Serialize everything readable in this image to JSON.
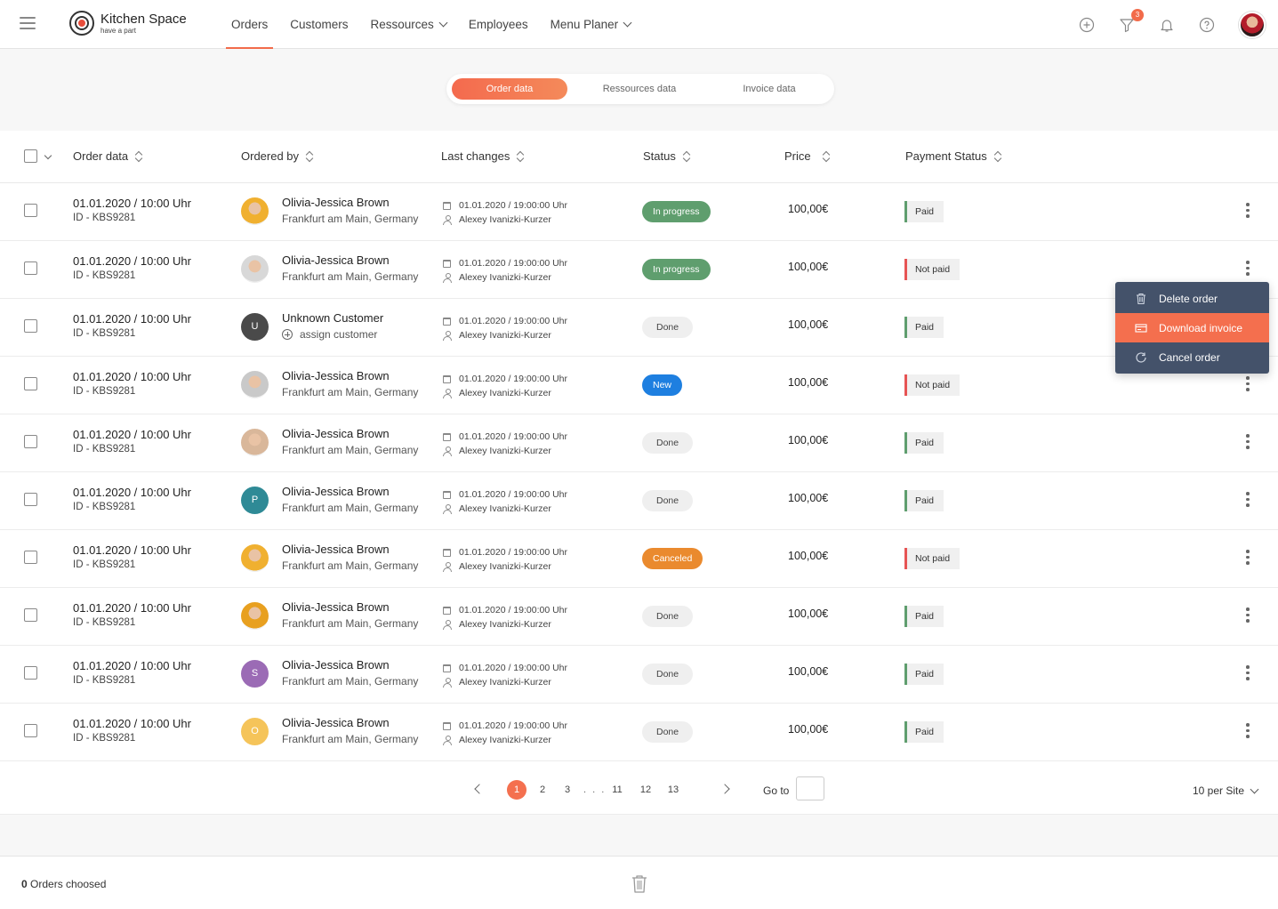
{
  "brand": {
    "name": "Kitchen Space",
    "tagline": "have a part"
  },
  "nav": [
    {
      "label": "Orders",
      "active": true
    },
    {
      "label": "Customers"
    },
    {
      "label": "Ressources",
      "dropdown": true
    },
    {
      "label": "Employees"
    },
    {
      "label": "Menu Planer",
      "dropdown": true
    }
  ],
  "header_icons": {
    "filter_badge": "3"
  },
  "tabs": [
    {
      "label": "Order data",
      "active": true
    },
    {
      "label": "Ressources data"
    },
    {
      "label": "Invoice data"
    }
  ],
  "columns": {
    "order": "Order data",
    "ordered_by": "Ordered by",
    "last_changes": "Last changes",
    "status": "Status",
    "price": "Price",
    "payment": "Payment Status"
  },
  "rows": [
    {
      "date": "01.01.2020  /  10:00 Uhr",
      "id": "ID - KBS9281",
      "name": "Olivia-Jessica Brown",
      "loc": "Frankfurt am Main, Germany",
      "avatar_type": "photo",
      "avatar_color": "#f0b030",
      "changed": "01.01.2020 / 19:00:00 Uhr",
      "changed_by": "Alexey Ivanizki-Kurzer",
      "status": "In progress",
      "status_kind": "progress",
      "price": "100,00€",
      "payment": "Paid",
      "paid": true
    },
    {
      "date": "01.01.2020  /  10:00 Uhr",
      "id": "ID - KBS9281",
      "name": "Olivia-Jessica Brown",
      "loc": "Frankfurt am Main, Germany",
      "avatar_type": "photo",
      "avatar_color": "#d8d8d8",
      "changed": "01.01.2020 / 19:00:00 Uhr",
      "changed_by": "Alexey Ivanizki-Kurzer",
      "status": "In progress",
      "status_kind": "progress",
      "price": "100,00€",
      "payment": "Not paid",
      "paid": false
    },
    {
      "date": "01.01.2020  /  10:00 Uhr",
      "id": "ID - KBS9281",
      "name": "Unknown Customer",
      "loc": "assign customer",
      "assign": true,
      "avatar_type": "letter",
      "avatar_letter": "U",
      "avatar_color": "#4a4a4a",
      "changed": "01.01.2020 / 19:00:00 Uhr",
      "changed_by": "Alexey Ivanizki-Kurzer",
      "status": "Done",
      "status_kind": "done",
      "price": "100,00€",
      "payment": "Paid",
      "paid": true
    },
    {
      "date": "01.01.2020  /  10:00 Uhr",
      "id": "ID - KBS9281",
      "name": "Olivia-Jessica Brown",
      "loc": "Frankfurt am Main, Germany",
      "avatar_type": "photo",
      "avatar_color": "#c9c9c9",
      "changed": "01.01.2020 / 19:00:00 Uhr",
      "changed_by": "Alexey Ivanizki-Kurzer",
      "status": "New",
      "status_kind": "new",
      "price": "100,00€",
      "payment": "Not paid",
      "paid": false
    },
    {
      "date": "01.01.2020  /  10:00 Uhr",
      "id": "ID - KBS9281",
      "name": "Olivia-Jessica Brown",
      "loc": "Frankfurt am Main, Germany",
      "avatar_type": "photo",
      "avatar_color": "#d9b79a",
      "changed": "01.01.2020 / 19:00:00 Uhr",
      "changed_by": "Alexey Ivanizki-Kurzer",
      "status": "Done",
      "status_kind": "done",
      "price": "100,00€",
      "payment": "Paid",
      "paid": true
    },
    {
      "date": "01.01.2020  /  10:00 Uhr",
      "id": "ID - KBS9281",
      "name": "Olivia-Jessica Brown",
      "loc": "Frankfurt am Main, Germany",
      "avatar_type": "letter",
      "avatar_letter": "P",
      "avatar_color": "#2f8a96",
      "changed": "01.01.2020 / 19:00:00 Uhr",
      "changed_by": "Alexey Ivanizki-Kurzer",
      "status": "Done",
      "status_kind": "done",
      "price": "100,00€",
      "payment": "Paid",
      "paid": true
    },
    {
      "date": "01.01.2020  /  10:00 Uhr",
      "id": "ID - KBS9281",
      "name": "Olivia-Jessica Brown",
      "loc": "Frankfurt am Main, Germany",
      "avatar_type": "photo",
      "avatar_color": "#f0b030",
      "changed": "01.01.2020 / 19:00:00 Uhr",
      "changed_by": "Alexey Ivanizki-Kurzer",
      "status": "Canceled",
      "status_kind": "canceled",
      "price": "100,00€",
      "payment": "Not paid",
      "paid": false
    },
    {
      "date": "01.01.2020  /  10:00 Uhr",
      "id": "ID - KBS9281",
      "name": "Olivia-Jessica Brown",
      "loc": "Frankfurt am Main, Germany",
      "avatar_type": "photo",
      "avatar_color": "#e8a020",
      "changed": "01.01.2020 / 19:00:00 Uhr",
      "changed_by": "Alexey Ivanizki-Kurzer",
      "status": "Done",
      "status_kind": "done",
      "price": "100,00€",
      "payment": "Paid",
      "paid": true
    },
    {
      "date": "01.01.2020  /  10:00 Uhr",
      "id": "ID - KBS9281",
      "name": "Olivia-Jessica Brown",
      "loc": "Frankfurt am Main, Germany",
      "avatar_type": "letter",
      "avatar_letter": "S",
      "avatar_color": "#9b6bb5",
      "changed": "01.01.2020 / 19:00:00 Uhr",
      "changed_by": "Alexey Ivanizki-Kurzer",
      "status": "Done",
      "status_kind": "done",
      "price": "100,00€",
      "payment": "Paid",
      "paid": true
    },
    {
      "date": "01.01.2020  /  10:00 Uhr",
      "id": "ID - KBS9281",
      "name": "Olivia-Jessica Brown",
      "loc": "Frankfurt am Main, Germany",
      "avatar_type": "letter",
      "avatar_letter": "O",
      "avatar_color": "#f5c45a",
      "changed": "01.01.2020 / 19:00:00 Uhr",
      "changed_by": "Alexey Ivanizki-Kurzer",
      "status": "Done",
      "status_kind": "done",
      "price": "100,00€",
      "payment": "Paid",
      "paid": true
    }
  ],
  "pagination": {
    "pages": [
      "1",
      "2",
      "3",
      "11",
      "12",
      "13"
    ],
    "current": "1",
    "ellipsis": ". . .",
    "goto_label": "Go to",
    "per_page": "10 per Site"
  },
  "context_menu": [
    {
      "label": "Delete order",
      "icon": "trash-icon"
    },
    {
      "label": "Download invoice",
      "icon": "invoice-icon",
      "highlighted": true
    },
    {
      "label": "Cancel order",
      "icon": "refresh-icon"
    }
  ],
  "footer": {
    "count": "0",
    "label": " Orders choosed"
  }
}
